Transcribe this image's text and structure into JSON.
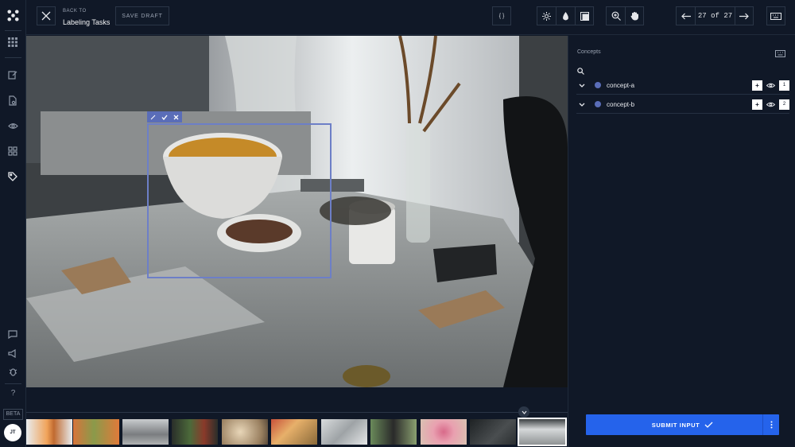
{
  "header": {
    "back_small": "BACK TO",
    "back_title": "Labeling Tasks",
    "save_draft": "SAVE DRAFT",
    "code_label": "{ }",
    "page_current": "27",
    "page_sep": "of",
    "page_total": "27"
  },
  "rail": {
    "help": "?",
    "beta": "BETA",
    "avatar": "JT"
  },
  "panel": {
    "title": "Concepts",
    "concepts": [
      {
        "name": "concept-a",
        "color": "#5a6db8",
        "shortcut": "1",
        "add": "+"
      },
      {
        "name": "concept-b",
        "color": "#5a6db8",
        "shortcut": "2",
        "add": "+"
      }
    ],
    "submit_label": "SUBMIT INPUT"
  },
  "annotation": {
    "concept": "concept-a",
    "tool_icons": [
      "edit-icon",
      "check-icon",
      "close-icon"
    ]
  },
  "filmstrip": {
    "count": 11,
    "active_index": 10
  },
  "colors": {
    "accent": "#2563eb",
    "bbox": "#6d7fc7",
    "background": "#101827"
  }
}
